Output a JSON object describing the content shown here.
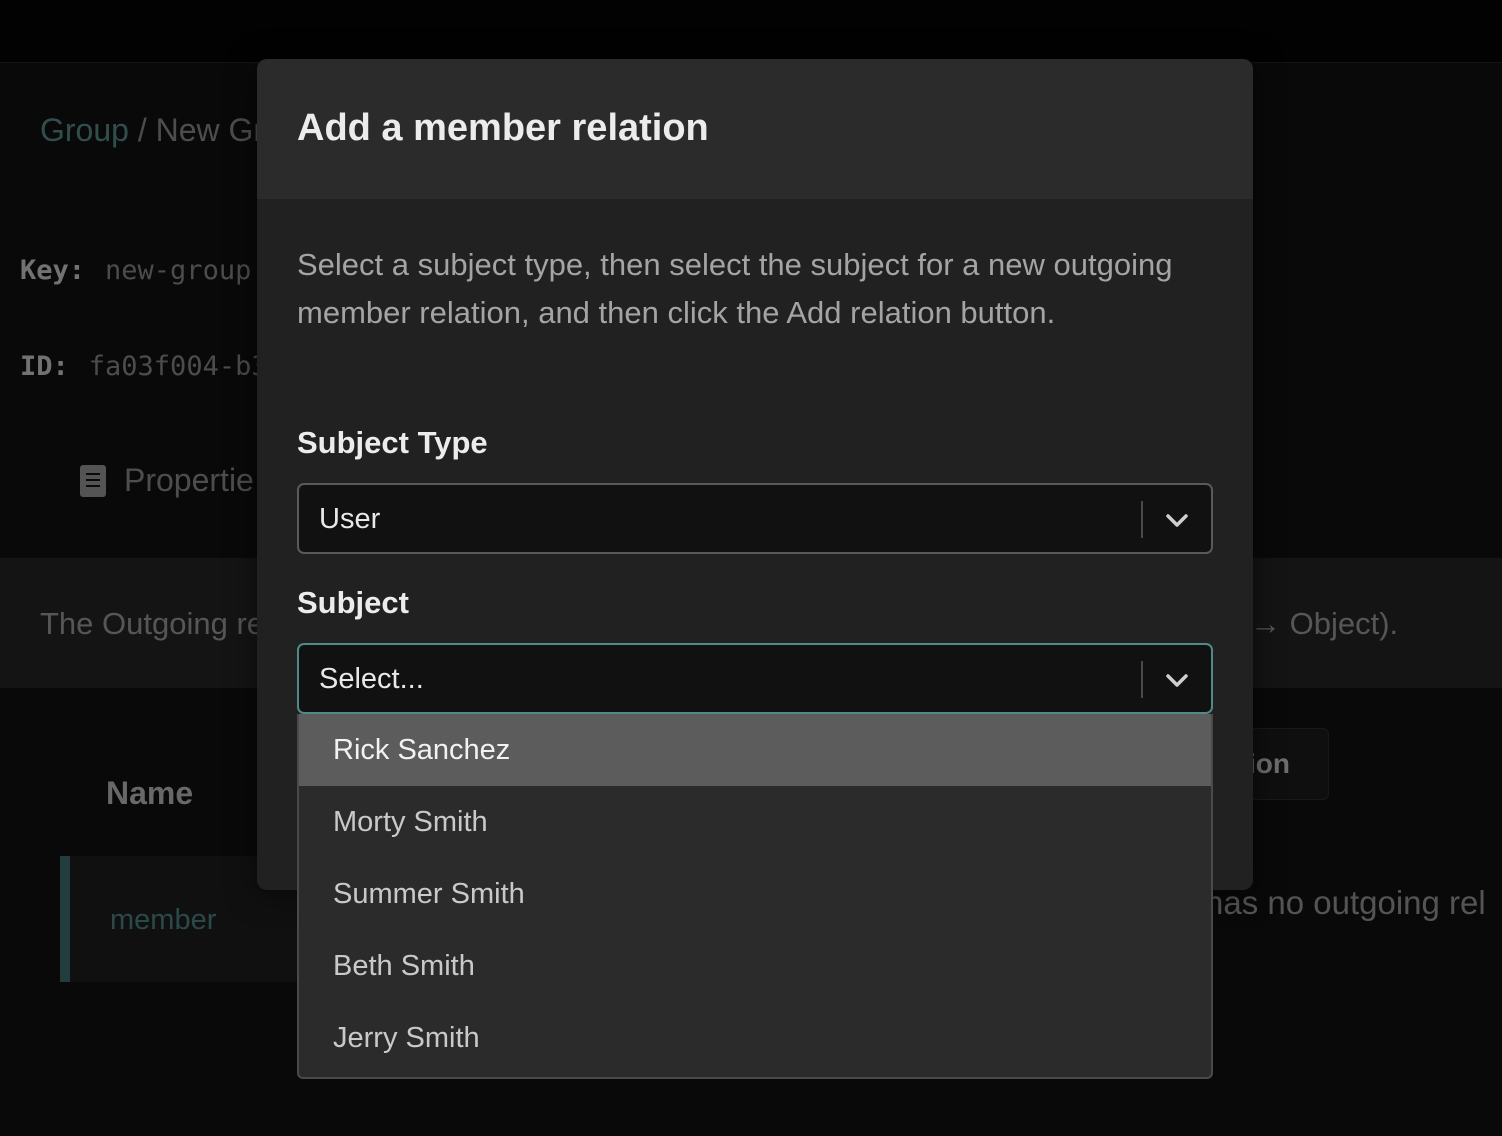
{
  "breadcrumb": {
    "root": "Group",
    "separator": " / ",
    "current": "New Gr"
  },
  "meta": {
    "key_label": "Key:",
    "key_value": "new-group",
    "id_label": "ID:",
    "id_value": "fa03f004-b3"
  },
  "tabs": {
    "properties_label": "Propertie"
  },
  "banner": {
    "text": "The Outgoing re",
    "tail": "→ Object)."
  },
  "table": {
    "name_header": "Name",
    "rows": [
      {
        "name": "member"
      }
    ]
  },
  "background": {
    "add_button_fragment": "tion",
    "empty_fragment": "has no outgoing rel"
  },
  "modal": {
    "title": "Add a member relation",
    "description": "Select a subject type, then select the subject for a new outgoing member relation, and then click the Add relation button.",
    "subject_type": {
      "label": "Subject Type",
      "value": "User"
    },
    "subject": {
      "label": "Subject",
      "placeholder": "Select..."
    },
    "options": [
      {
        "label": "Rick Sanchez",
        "highlighted": true
      },
      {
        "label": "Morty Smith",
        "highlighted": false
      },
      {
        "label": "Summer Smith",
        "highlighted": false
      },
      {
        "label": "Beth Smith",
        "highlighted": false
      },
      {
        "label": "Jerry Smith",
        "highlighted": false
      }
    ]
  },
  "colors": {
    "accent": "#4f8b89",
    "link": "#5a8e8c",
    "modal_bg": "#212121",
    "option_highlight": "#5c5c5c"
  },
  "icons": [
    "properties-icon",
    "chevron-down-icon"
  ]
}
